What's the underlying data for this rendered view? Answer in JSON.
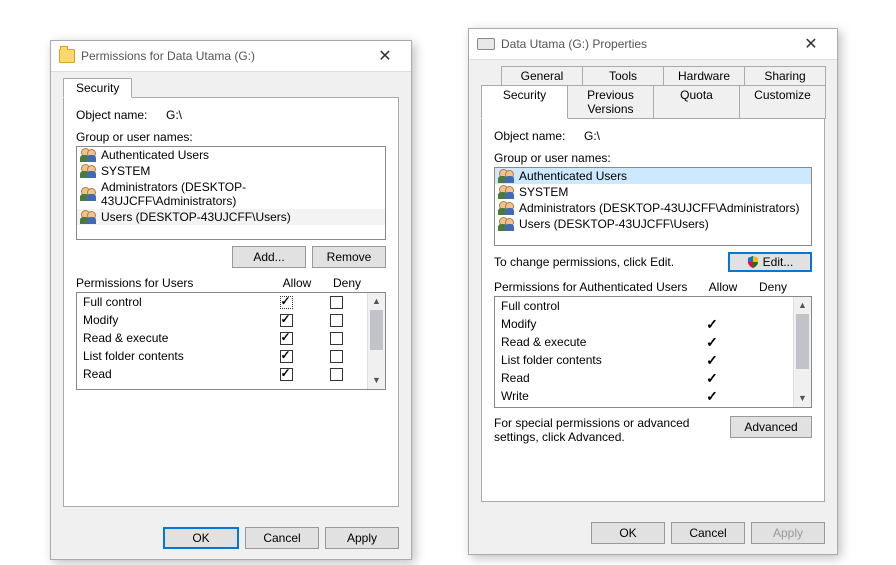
{
  "left": {
    "title": "Permissions for Data Utama (G:)",
    "tabs": {
      "security": "Security"
    },
    "objectNameLabel": "Object name:",
    "objectName": "G:\\",
    "groupLabel": "Group or user names:",
    "users": [
      "Authenticated Users",
      "SYSTEM",
      "Administrators (DESKTOP-43UJCFF\\Administrators)",
      "Users (DESKTOP-43UJCFF\\Users)"
    ],
    "addBtn": "Add...",
    "removeBtn": "Remove",
    "permHeaderLabel": "Permissions for Users",
    "allow": "Allow",
    "deny": "Deny",
    "perms": [
      {
        "name": "Full control",
        "allow": true,
        "deny": false,
        "allowDotted": true
      },
      {
        "name": "Modify",
        "allow": true,
        "deny": false
      },
      {
        "name": "Read & execute",
        "allow": true,
        "deny": false
      },
      {
        "name": "List folder contents",
        "allow": true,
        "deny": false
      },
      {
        "name": "Read",
        "allow": true,
        "deny": false
      }
    ],
    "ok": "OK",
    "cancel": "Cancel",
    "apply": "Apply"
  },
  "right": {
    "title": "Data Utama (G:) Properties",
    "tabsRow1": [
      "General",
      "Tools",
      "Hardware",
      "Sharing"
    ],
    "tabsRow2": [
      "Security",
      "Previous Versions",
      "Quota",
      "Customize"
    ],
    "objectNameLabel": "Object name:",
    "objectName": "G:\\",
    "groupLabel": "Group or user names:",
    "users": [
      "Authenticated Users",
      "SYSTEM",
      "Administrators (DESKTOP-43UJCFF\\Administrators)",
      "Users (DESKTOP-43UJCFF\\Users)"
    ],
    "changeLabel": "To change permissions, click Edit.",
    "editBtn": "Edit...",
    "permHeaderLabel": "Permissions for Authenticated Users",
    "allow": "Allow",
    "deny": "Deny",
    "perms": [
      {
        "name": "Full control",
        "allow": false
      },
      {
        "name": "Modify",
        "allow": true
      },
      {
        "name": "Read & execute",
        "allow": true
      },
      {
        "name": "List folder contents",
        "allow": true
      },
      {
        "name": "Read",
        "allow": true
      },
      {
        "name": "Write",
        "allow": true
      }
    ],
    "specialText": "For special permissions or advanced settings, click Advanced.",
    "advancedBtn": "Advanced",
    "ok": "OK",
    "cancel": "Cancel",
    "apply": "Apply"
  }
}
